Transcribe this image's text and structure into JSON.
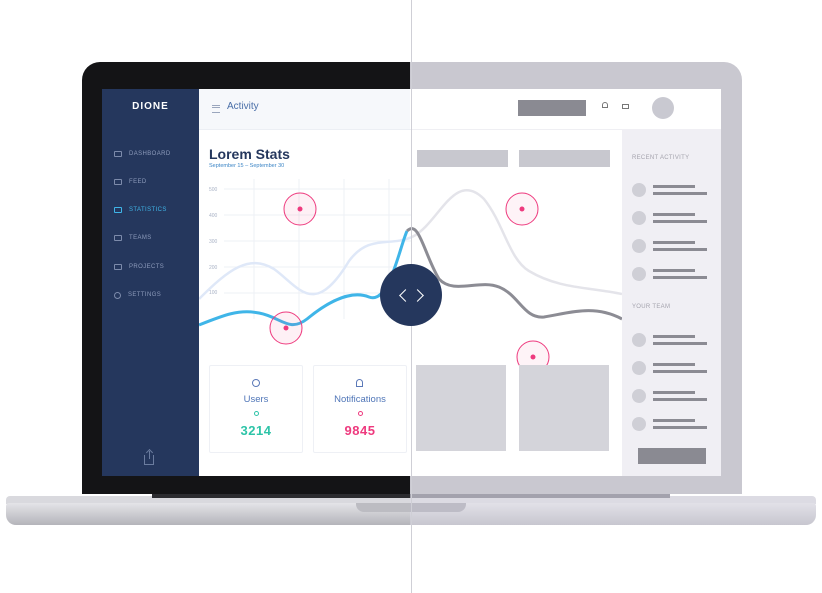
{
  "sidebar": {
    "logo": "DIONE",
    "items": [
      {
        "label": "DASHBOARD",
        "icon": "dashboard-icon",
        "active": false
      },
      {
        "label": "FEED",
        "icon": "feed-icon",
        "active": false
      },
      {
        "label": "STATISTICS",
        "icon": "statistics-icon",
        "active": true
      },
      {
        "label": "TEAMS",
        "icon": "teams-icon",
        "active": false
      },
      {
        "label": "PROJECTS",
        "icon": "projects-icon",
        "active": false
      },
      {
        "label": "SETTINGS",
        "icon": "settings-icon",
        "active": false
      }
    ],
    "footer_icon": "share-icon"
  },
  "topbar": {
    "title": "Activity",
    "icons": [
      "menu-icon",
      "bell-icon",
      "chat-icon"
    ]
  },
  "stats": {
    "title": "Lorem Stats",
    "subtitle": "September 15 – September 30",
    "y_ticks": [
      "500",
      "400",
      "300",
      "200",
      "100"
    ]
  },
  "cards": [
    {
      "label": "Users",
      "value": "3214",
      "icon": "user-icon",
      "color": "#2ec4a8"
    },
    {
      "label": "Notifications",
      "value": "9845",
      "icon": "bell-icon",
      "color": "#ee3a7e"
    }
  ],
  "wireframe": {
    "recent_activity": "RECENT ACTIVITY",
    "your_team": "YOUR TEAM"
  },
  "colors": {
    "sidebar": "#25375d",
    "accent": "#3fb5e8",
    "highlight": "#ee3a7e",
    "wire": "#8a8a92"
  }
}
